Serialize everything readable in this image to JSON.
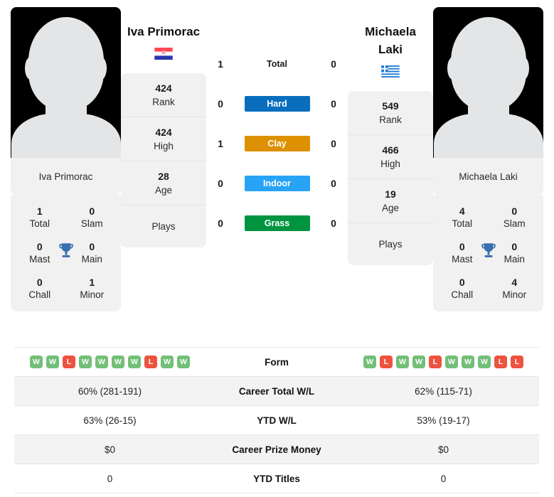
{
  "players": {
    "left": {
      "name": "Iva Primorac",
      "photo_caption": "Iva Primorac",
      "flag": "croatia-flag",
      "rank": "424",
      "rank_label": "Rank",
      "high": "424",
      "high_label": "High",
      "age": "28",
      "age_label": "Age",
      "plays": "",
      "plays_label": "Plays",
      "trophies": {
        "total": "1",
        "total_label": "Total",
        "slam": "0",
        "slam_label": "Slam",
        "mast": "0",
        "mast_label": "Mast",
        "main": "0",
        "main_label": "Main",
        "chall": "0",
        "chall_label": "Chall",
        "minor": "1",
        "minor_label": "Minor"
      },
      "form": [
        "W",
        "W",
        "L",
        "W",
        "W",
        "W",
        "W",
        "L",
        "W",
        "W"
      ],
      "career_wl": "60% (281-191)",
      "ytd_wl": "63% (26-15)",
      "career_prize": "$0",
      "ytd_titles": "0"
    },
    "right": {
      "name_line1": "Michaela",
      "name_line2": "Laki",
      "photo_caption": "Michaela Laki",
      "flag": "greece-flag",
      "rank": "549",
      "rank_label": "Rank",
      "high": "466",
      "high_label": "High",
      "age": "19",
      "age_label": "Age",
      "plays": "",
      "plays_label": "Plays",
      "trophies": {
        "total": "4",
        "total_label": "Total",
        "slam": "0",
        "slam_label": "Slam",
        "mast": "0",
        "mast_label": "Mast",
        "main": "0",
        "main_label": "Main",
        "chall": "0",
        "chall_label": "Chall",
        "minor": "4",
        "minor_label": "Minor"
      },
      "form": [
        "W",
        "L",
        "W",
        "W",
        "L",
        "W",
        "W",
        "W",
        "L",
        "L"
      ],
      "career_wl": "62% (115-71)",
      "ytd_wl": "53% (19-17)",
      "career_prize": "$0",
      "ytd_titles": "0"
    }
  },
  "head_to_head": [
    {
      "label": "Total",
      "left": "1",
      "right": "0",
      "color": ""
    },
    {
      "label": "Hard",
      "left": "0",
      "right": "0",
      "color": "#0a6ebd"
    },
    {
      "label": "Clay",
      "left": "1",
      "right": "0",
      "color": "#dd9000"
    },
    {
      "label": "Indoor",
      "left": "0",
      "right": "0",
      "color": "#29a3f5"
    },
    {
      "label": "Grass",
      "left": "0",
      "right": "0",
      "color": "#019440"
    }
  ],
  "table_rows": [
    {
      "label": "Form"
    },
    {
      "label": "Career Total W/L"
    },
    {
      "label": "YTD W/L"
    },
    {
      "label": "Career Prize Money"
    },
    {
      "label": "YTD Titles"
    }
  ],
  "colors": {
    "win_badge": "#72bf78",
    "loss_badge": "#ee5340",
    "trophy": "#3a6fb0",
    "panel_bg": "#f1f1f1"
  }
}
